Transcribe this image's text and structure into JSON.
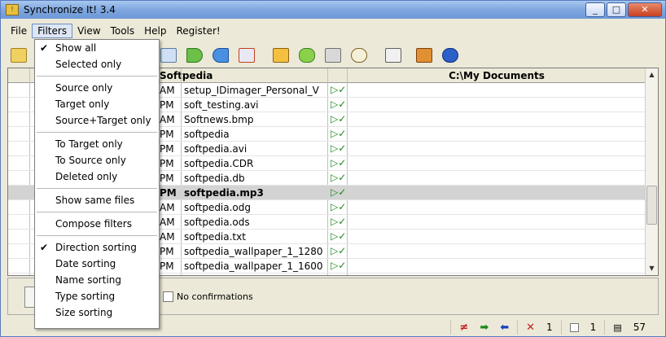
{
  "window": {
    "title": "Synchronize It! 3.4",
    "app_icon": "app-icon"
  },
  "titlebar_buttons": {
    "minimize": "_",
    "maximize": "□",
    "close": "✕"
  },
  "menu": [
    {
      "label": "File"
    },
    {
      "label": "Filters"
    },
    {
      "label": "View"
    },
    {
      "label": "Tools"
    },
    {
      "label": "Help"
    },
    {
      "label": "Register!"
    }
  ],
  "toolbar_icons": [
    "open-folder-icon",
    "compare-icon",
    "copy-right-icon",
    "copy-left-icon",
    "delete-icon",
    "clear-icon",
    "refresh-icon",
    "print-icon",
    "find-icon",
    "sync-icon",
    "settings-icon",
    "help-icon"
  ],
  "grid": {
    "left_header": "Softpedia",
    "right_header": "C:\\My Documents",
    "rows": [
      {
        "time": "AM",
        "name": "setup_IDimager_Personal_V",
        "dir": "▷✓",
        "selected": false
      },
      {
        "time": "PM",
        "name": "soft_testing.avi",
        "dir": "▷✓",
        "selected": false
      },
      {
        "time": "AM",
        "name": "Softnews.bmp",
        "dir": "▷✓",
        "selected": false
      },
      {
        "time": "PM",
        "name": "softpedia",
        "dir": "▷✓",
        "selected": false
      },
      {
        "time": "PM",
        "name": "softpedia.avi",
        "dir": "▷✓",
        "selected": false
      },
      {
        "time": "PM",
        "name": "softpedia.CDR",
        "dir": "▷✓",
        "selected": false
      },
      {
        "time": "PM",
        "name": "softpedia.db",
        "dir": "▷✓",
        "selected": false
      },
      {
        "time": "PM",
        "name": "softpedia.mp3",
        "dir": "▷✓",
        "selected": true
      },
      {
        "time": "AM",
        "name": "softpedia.odg",
        "dir": "▷✓",
        "selected": false
      },
      {
        "time": "AM",
        "name": "softpedia.ods",
        "dir": "▷✓",
        "selected": false
      },
      {
        "time": "AM",
        "name": "softpedia.txt",
        "dir": "▷✓",
        "selected": false
      },
      {
        "time": "PM",
        "name": "softpedia_wallpaper_1_1280",
        "dir": "▷✓",
        "selected": false
      },
      {
        "time": "PM",
        "name": "softpedia_wallpaper_1_1600",
        "dir": "▷✓",
        "selected": false
      }
    ]
  },
  "options": {
    "no_confirmations": "No confirmations"
  },
  "status": {
    "diff_icon": "≠",
    "right_arrow": "➡",
    "left_arrow": "⬅",
    "delete_icon": "✕",
    "delete_count": "1",
    "check_count": "1",
    "total_count": "57"
  },
  "filters_menu": {
    "show_all": "Show all",
    "selected_only": "Selected only",
    "source_only": "Source only",
    "target_only": "Target only",
    "source_target_only": "Source+Target only",
    "to_target_only": "To Target only",
    "to_source_only": "To Source only",
    "deleted_only": "Deleted only",
    "show_same_files": "Show same files",
    "compose_filters": "Compose filters",
    "direction_sorting": "Direction sorting",
    "date_sorting": "Date sorting",
    "name_sorting": "Name sorting",
    "type_sorting": "Type sorting",
    "size_sorting": "Size sorting",
    "check_mark": "✔"
  }
}
